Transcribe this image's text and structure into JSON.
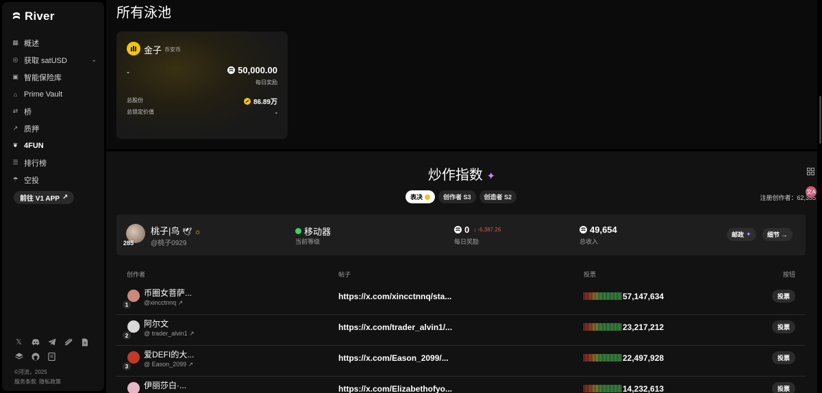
{
  "app": {
    "name": "River"
  },
  "sidebar": {
    "items": [
      {
        "label": "概述",
        "icon": "dashboard-icon"
      },
      {
        "label": "获取 satUSD",
        "icon": "target-icon",
        "has_chevron": true
      },
      {
        "label": "智能保险库",
        "icon": "vault-icon"
      },
      {
        "label": "Prime Vault",
        "icon": "bank-icon"
      },
      {
        "label": "桥",
        "icon": "swap-icon"
      },
      {
        "label": "质押",
        "icon": "chart-up-icon"
      },
      {
        "label": "4FUN",
        "icon": "fun-icon",
        "active": true
      },
      {
        "label": "排行榜",
        "icon": "list-icon"
      },
      {
        "label": "空投",
        "icon": "airdrop-icon"
      }
    ],
    "v1_button": "前往 V1 APP",
    "copyright": "©河流，2025",
    "legal": [
      "服务条款",
      "隐私政策"
    ]
  },
  "pools": {
    "title": "所有泳池",
    "card": {
      "name": "金子",
      "subtitle": "币安币",
      "dash": "-",
      "daily_reward": "50,000.00",
      "daily_reward_label": "每日奖励",
      "shares_label": "总股份",
      "shares": "86.89万",
      "tvl_label": "总锁定价值",
      "tvl": "-"
    }
  },
  "hype": {
    "title": "炒作指数",
    "tabs": [
      "表决",
      "创作者 S3",
      "创造者 S2"
    ],
    "registered_label": "注册创作者：",
    "registered_count": "62,355",
    "me": {
      "badge": "285",
      "name": "桃子|鸟",
      "handle": "@桃子0929",
      "level": "移动器",
      "level_label": "当前等级",
      "daily_reward": "0",
      "daily_delta": "-6,387.26",
      "daily_reward_label": "每日奖励",
      "total_income": "49,654",
      "total_income_label": "总收入",
      "mail_button": "邮政",
      "details_button": "细节 →"
    },
    "table": {
      "headers": {
        "creator": "创作者",
        "post": "帖子",
        "votes": "投票",
        "action": "按钮"
      },
      "rows": [
        {
          "rank": "1",
          "name": "币圈女菩萨...",
          "handle": "@xincctnnq ↗",
          "post": "https://x.com/xincctnnq/sta...",
          "votes": "57,147,634",
          "button": "投票",
          "avatar_color": "#c98a7a"
        },
        {
          "rank": "2",
          "name": "阿尔文",
          "handle": "@ trader_alvin1 ↗",
          "post": "https://x.com/trader_alvin1/...",
          "votes": "23,217,212",
          "button": "投票",
          "avatar_color": "#d8d8d8"
        },
        {
          "rank": "3",
          "name": "爱DEFI的大...",
          "handle": "@ Eason_2099 ↗",
          "post": "https://x.com/Eason_2099/...",
          "votes": "22,497,928",
          "button": "投票",
          "avatar_color": "#c0392b"
        },
        {
          "rank": "4",
          "name": "伊丽莎白·...",
          "handle": "",
          "post": "https://x.com/Elizabethofyo...",
          "votes": "14,232,613",
          "button": "投票",
          "avatar_color": "#e5b8c8"
        }
      ]
    }
  }
}
